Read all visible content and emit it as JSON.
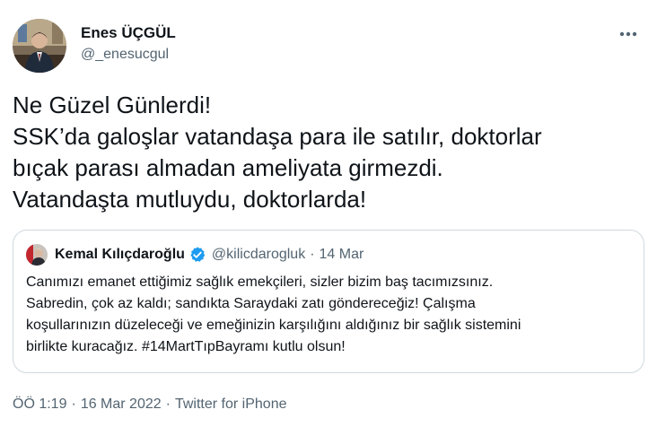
{
  "author": {
    "display_name": "Enes ÜÇGÜL",
    "handle": "@_enesucgul",
    "avatar_icon": "user-avatar"
  },
  "more_icon": "ellipsis-icon",
  "tweet": {
    "lines": [
      "Ne Güzel Günlerdi!",
      "SSK’da galoşlar vatandaşa para ile satılır, doktorlar",
      "bıçak parası almadan ameliyata girmezdi.",
      "Vatandaşta mutluydu, doktorlarda!"
    ]
  },
  "quoted": {
    "display_name": "Kemal Kılıçdaroğlu",
    "verified_icon": "verified-badge-icon",
    "handle": "@kilicdarogluk",
    "separator": "·",
    "date": "14 Mar",
    "lines": [
      "Canımızı emanet ettiğimiz sağlık emekçileri, sizler bizim baş tacımızsınız.",
      "Sabredin, çok az kaldı; sandıkta Saraydaki zatı göndereceğiz! Çalışma",
      "koşullarınızın düzeleceği ve emeğinizin karşılığını aldığınız bir sağlık sistemini",
      "birlikte kuracağız. #14MartTıpBayramı kutlu olsun!"
    ]
  },
  "meta": {
    "time": "ÖÖ 1:19",
    "separator1": "·",
    "date": "16 Mar 2022",
    "separator2": "·",
    "source": "Twitter for iPhone"
  },
  "colors": {
    "text_primary": "#0f1419",
    "text_secondary": "#536471",
    "border": "#cfd9de",
    "verified_blue": "#1d9bf0"
  }
}
